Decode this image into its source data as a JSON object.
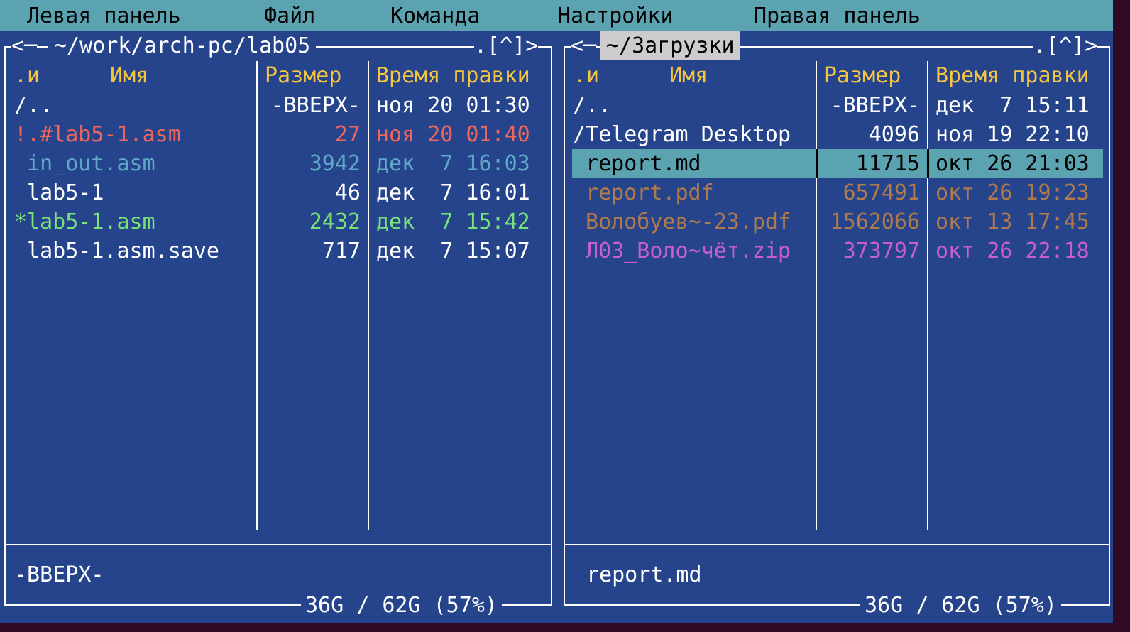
{
  "menu": {
    "items": [
      "Левая панель",
      "Файл",
      "Команда",
      "Настройки",
      "Правая панель"
    ]
  },
  "columns": {
    "flag": ".и",
    "name": "Имя",
    "size": "Размер",
    "time": "Время правки"
  },
  "controls": {
    "left_arrow": "<─",
    "right_controls": ".[^]>"
  },
  "left_panel": {
    "path": "~/work/arch-pc/lab05",
    "rows": [
      {
        "name": "/..",
        "size": "-ВВЕРХ-",
        "time": "ноя 20 01:30",
        "color": "#ffffff"
      },
      {
        "name": "!.#lab5-1.asm",
        "size": "27",
        "time": "ноя 20 01:40",
        "color": "#f0665c"
      },
      {
        "name": " in_out.asm",
        "size": "3942",
        "time": "дек  7 16:03",
        "color": "#5fa8c6"
      },
      {
        "name": " lab5-1",
        "size": "46",
        "time": "дек  7 16:01",
        "color": "#ffffff"
      },
      {
        "name": "*lab5-1.asm",
        "size": "2432",
        "time": "дек  7 15:42",
        "color": "#79e37a"
      },
      {
        "name": " lab5-1.asm.save",
        "size": "717",
        "time": "дек  7 15:07",
        "color": "#ffffff"
      }
    ],
    "status": "-ВВЕРХ-",
    "disk": "36G / 62G (57%)"
  },
  "right_panel": {
    "path": "~/Загрузки",
    "rows": [
      {
        "name": "/..",
        "size": "-ВВЕРХ-",
        "time": "дек  7 15:11",
        "color": "#ffffff"
      },
      {
        "name": "/Telegram Desktop",
        "size": "4096",
        "time": "ноя 19 22:10",
        "color": "#ffffff"
      },
      {
        "name": " report.md",
        "size": "11715",
        "time": "окт 26 21:03",
        "color": "#000000",
        "selected": true
      },
      {
        "name": " report.pdf",
        "size": "657491",
        "time": "окт 26 19:23",
        "color": "#b07a4c"
      },
      {
        "name": " Волобуев~-23.pdf",
        "size": "1562066",
        "time": "окт 13 17:45",
        "color": "#b07a4c"
      },
      {
        "name": " Л03_Воло~чёт.zip",
        "size": "373797",
        "time": "окт 26 22:18",
        "color": "#c85ecf"
      }
    ],
    "status": "report.md",
    "disk": "36G / 62G (57%)"
  },
  "colors": {
    "background": "#26448c",
    "menubar": "#5ba3b1",
    "header": "#f5c542",
    "selection": "#5ba3b1"
  }
}
